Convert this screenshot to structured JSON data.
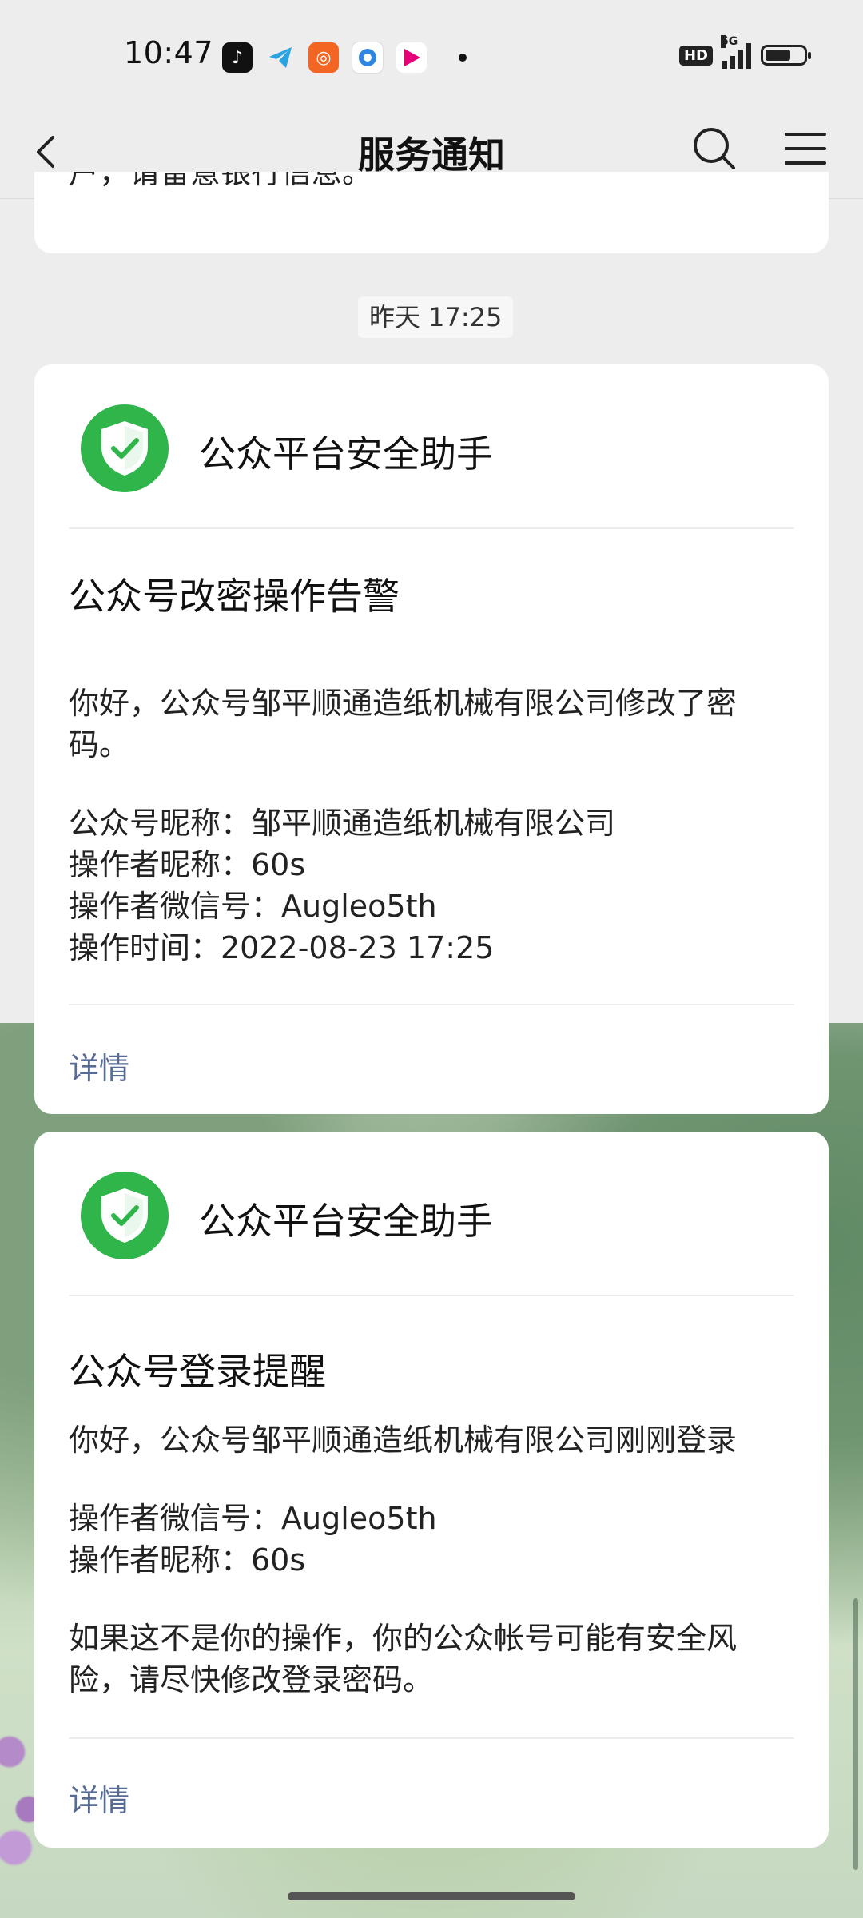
{
  "status_bar": {
    "time": "10:47",
    "app_icons": [
      "tiktok-icon",
      "telegram-icon",
      "kuaishou-icon",
      "browser-icon",
      "video-app-icon"
    ],
    "hd_label": "HD",
    "network_label": "5G"
  },
  "nav": {
    "title": "服务通知"
  },
  "previous_message": {
    "tail_text": "户，请留意银行信息。"
  },
  "timestamp": "昨天 17:25",
  "messages": [
    {
      "sender": "公众平台安全助手",
      "title": "公众号改密操作告警",
      "intro_line1": "你好，公众号邹平顺通造纸机械有限公司修改了密",
      "intro_line2": "码。",
      "fields": [
        "公众号昵称：邹平顺通造纸机械有限公司",
        "操作者昵称：60s",
        "操作者微信号：Augleo5th",
        "操作时间：2022-08-23 17:25"
      ],
      "detail_label": "详情"
    },
    {
      "sender": "公众平台安全助手",
      "title": "公众号登录提醒",
      "intro_line1": "你好，公众号邹平顺通造纸机械有限公司刚刚登录",
      "fields": [
        "操作者微信号：Augleo5th",
        "操作者昵称：60s"
      ],
      "warning_line1": "如果这不是你的操作，你的公众帐号可能有安全风",
      "warning_line2": "险，请尽快修改登录密码。",
      "detail_label": "详情"
    }
  ],
  "colors": {
    "accent_link": "#576b95",
    "shield_green": "#2fb54a",
    "page_bg": "#ededed"
  }
}
